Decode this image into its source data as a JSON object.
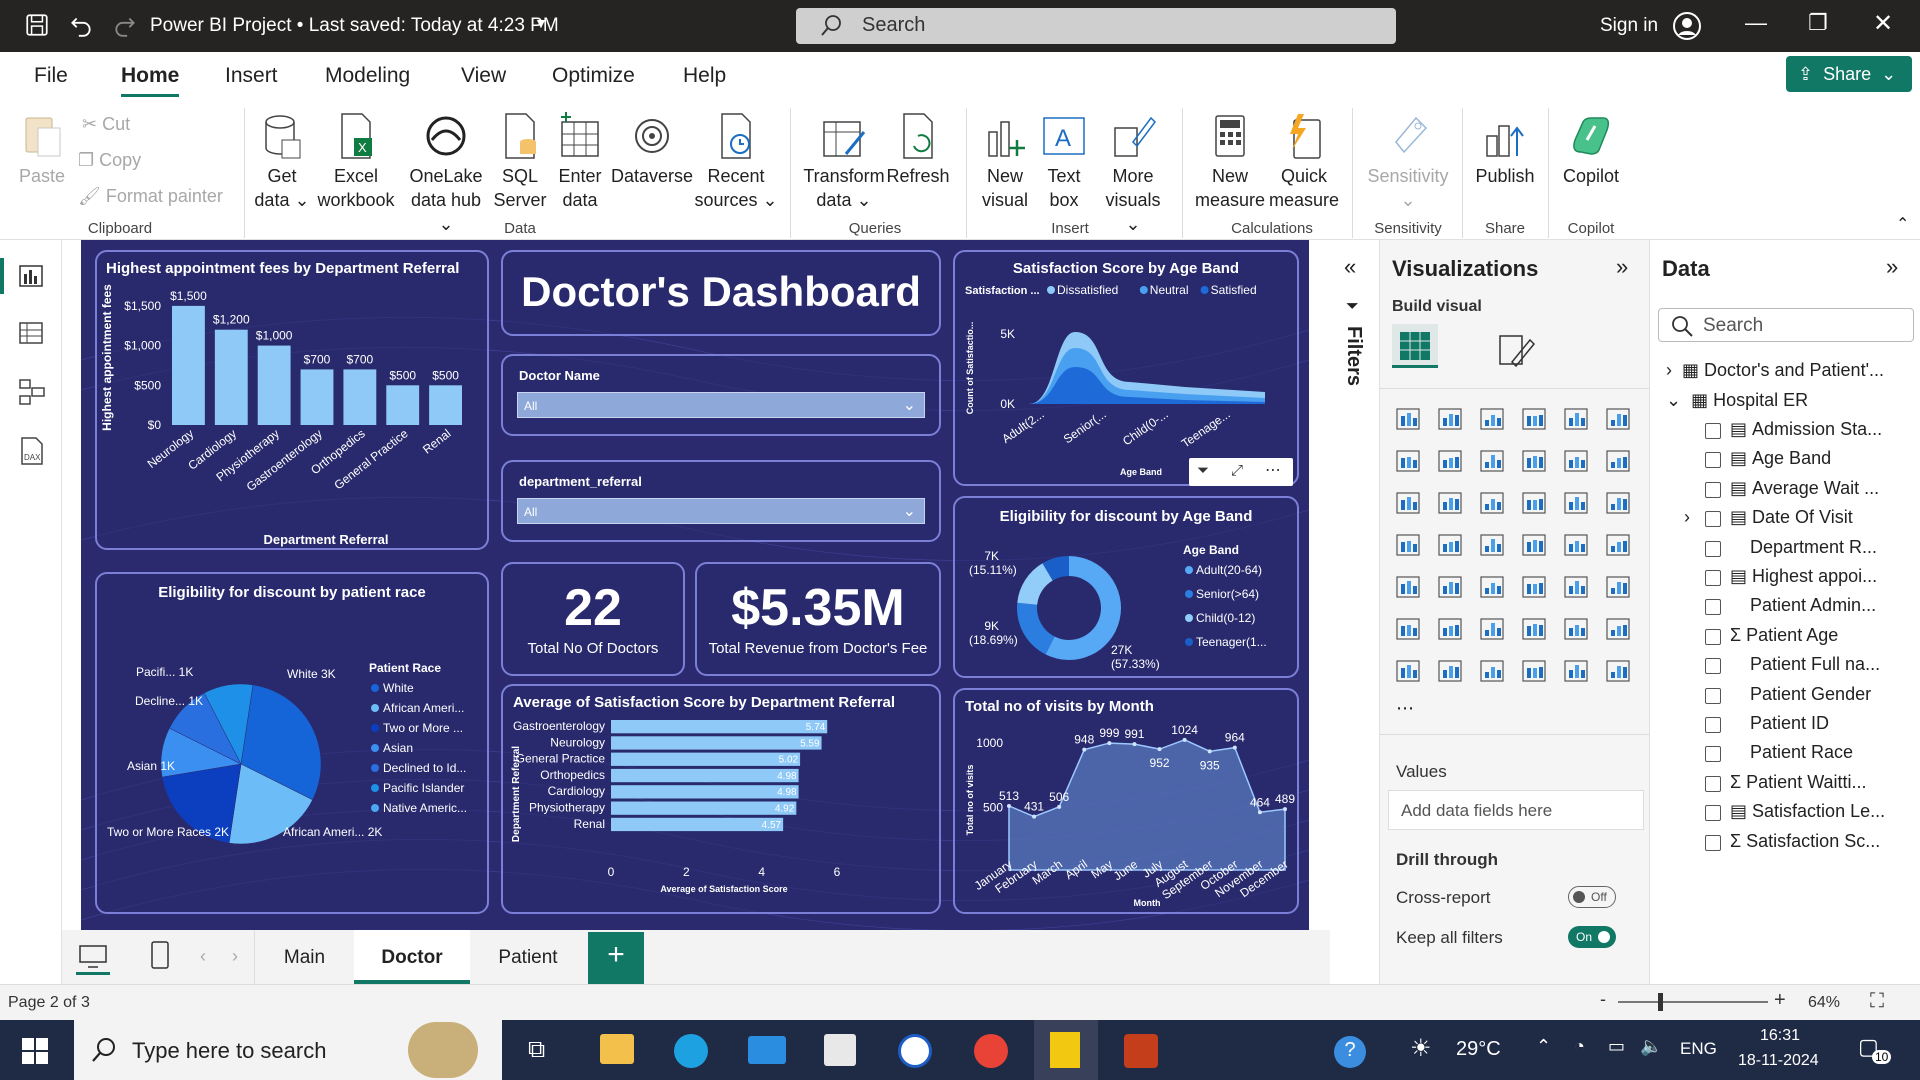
{
  "window": {
    "title": "Power BI Project • Last saved: Today at 4:23 PM",
    "search_placeholder": "Search",
    "signin": "Sign in"
  },
  "menu": {
    "items": [
      "File",
      "Home",
      "Insert",
      "Modeling",
      "View",
      "Optimize",
      "Help"
    ],
    "active": "Home",
    "share": "Share"
  },
  "ribbon": {
    "clipboard": {
      "paste": "Paste",
      "cut": "Cut",
      "copy": "Copy",
      "format_painter": "Format painter",
      "group": "Clipboard"
    },
    "data": {
      "get_data": [
        "Get",
        "data"
      ],
      "excel": [
        "Excel",
        "workbook"
      ],
      "onelake": [
        "OneLake",
        "data hub"
      ],
      "sql": [
        "SQL",
        "Server"
      ],
      "enter": [
        "Enter",
        "data"
      ],
      "dataverse": "Dataverse",
      "recent": [
        "Recent",
        "sources"
      ],
      "group": "Data"
    },
    "queries": {
      "transform": [
        "Transform",
        "data"
      ],
      "refresh": "Refresh",
      "group": "Queries"
    },
    "insert": {
      "new_visual": [
        "New",
        "visual"
      ],
      "text_box": [
        "Text",
        "box"
      ],
      "more_visuals": [
        "More",
        "visuals"
      ],
      "group": "Insert"
    },
    "calculations": {
      "new_measure": [
        "New",
        "measure"
      ],
      "quick_measure": [
        "Quick",
        "measure"
      ],
      "group": "Calculations"
    },
    "sensitivity": {
      "label": "Sensitivity",
      "group": "Sensitivity"
    },
    "share": {
      "publish": "Publish",
      "group": "Share"
    },
    "copilot": {
      "label": "Copilot",
      "group": "Copilot"
    }
  },
  "dashboard": {
    "title": "Doctor's Dashboard",
    "fees_chart_title": "Highest appointment fees by Department Referral",
    "race_chart_title": "Eligibility for discount by patient race",
    "satisfaction_age_title": "Satisfaction Score by Age Band",
    "eligibility_age_title": "Eligibility for discount by Age Band",
    "avg_sat_title": "Average of Satisfaction Score by Department Referral",
    "visits_title": "Total no of visits by Month",
    "slicer1": {
      "label": "Doctor Name",
      "value": "All"
    },
    "slicer2": {
      "label": "department_referral",
      "value": "All"
    },
    "kpi1": {
      "value": "22",
      "label": "Total No Of Doctors"
    },
    "kpi2": {
      "value": "$5.35M",
      "label": "Total Revenue from Doctor's Fee"
    }
  },
  "chart_data": [
    {
      "type": "bar",
      "title": "Highest appointment fees by Department Referral",
      "categories": [
        "Neurology",
        "Cardiology",
        "Physiotherapy",
        "Gastroenterology",
        "Orthopedics",
        "General Practice",
        "Renal"
      ],
      "values": [
        1500,
        1200,
        1000,
        700,
        700,
        500,
        500
      ],
      "data_labels": [
        "$1,500",
        "$1,200",
        "$1,000",
        "$700",
        "$700",
        "$500",
        "$500"
      ],
      "xlabel": "Department Referral",
      "ylabel": "Highest appointment fees",
      "ylim": [
        0,
        1700
      ],
      "yticks": [
        "$0",
        "$500",
        "$1,000",
        "$1,500"
      ],
      "color": "#8ec9f7"
    },
    {
      "type": "area",
      "title": "Satisfaction Score by Age Band",
      "legend_title": "Satisfaction ...",
      "series_names": [
        "Dissatisfied",
        "Neutral",
        "Satisfied"
      ],
      "categories": [
        "Adult(2...",
        "Senior(...",
        "Child(0-...",
        "Teenage..."
      ],
      "xlabel": "Age Band",
      "ylabel": "Count of Satisfactio...",
      "yticks": [
        "0K",
        "5K"
      ]
    },
    {
      "type": "pie",
      "title": "Eligibility for discount by patient race",
      "legend_title": "Patient Race",
      "slices": [
        {
          "name": "White",
          "value": 3000,
          "label": "White 3K",
          "color": "#1565d8"
        },
        {
          "name": "African American",
          "value": 2000,
          "label": "African Ameri... 2K",
          "color": "#6cbcf7"
        },
        {
          "name": "Two or More Races",
          "value": 2000,
          "label": "Two or More Races 2K",
          "color": "#0b3fbf"
        },
        {
          "name": "Asian",
          "value": 1000,
          "label": "Asian 1K",
          "color": "#3a8ff0"
        },
        {
          "name": "Declined to Identify",
          "value": 1000,
          "label": "Decline... 1K",
          "color": "#2a6fe0"
        },
        {
          "name": "Pacific Islander",
          "value": 1000,
          "label": "Pacifi... 1K",
          "color": "#1e90e8"
        }
      ],
      "legend": [
        "White",
        "African Ameri...",
        "Two or More ...",
        "Asian",
        "Declined to Id...",
        "Pacific Islander",
        "Native Americ..."
      ]
    },
    {
      "type": "pie",
      "title": "Eligibility for discount by Age Band",
      "legend_title": "Age Band",
      "slices": [
        {
          "name": "Adult(20-64)",
          "value": 27000,
          "label": "27K (57.33%)",
          "color": "#57a8f5"
        },
        {
          "name": "Senior(>64)",
          "value": 9000,
          "label": "9K (18.69%)",
          "color": "#2b7de0"
        },
        {
          "name": "Child(0-12)",
          "value": 7000,
          "label": "7K (15.11%)",
          "color": "#92cdfa"
        },
        {
          "name": "Teenager(13-19)",
          "value": 4000,
          "label": "",
          "color": "#1a5fc8"
        }
      ],
      "legend": [
        "Adult(20-64)",
        "Senior(>64)",
        "Child(0-12)",
        "Teenager(1..."
      ]
    },
    {
      "type": "bar",
      "orientation": "horizontal",
      "title": "Average of Satisfaction Score by Department Referral",
      "categories": [
        "Gastroenterology",
        "Neurology",
        "General Practice",
        "Orthopedics",
        "Cardiology",
        "Physiotherapy",
        "Renal"
      ],
      "values": [
        5.74,
        5.59,
        5.02,
        4.98,
        4.98,
        4.92,
        4.57
      ],
      "xlabel": "Average of Satisfaction Score",
      "ylabel": "Department Referral",
      "xlim": [
        0,
        6
      ],
      "xticks": [
        "0",
        "2",
        "4",
        "6"
      ],
      "color": "#8ec9f7"
    },
    {
      "type": "area",
      "title": "Total no of visits by Month",
      "categories": [
        "January",
        "February",
        "March",
        "April",
        "May",
        "June",
        "July",
        "August",
        "September",
        "October",
        "November",
        "December"
      ],
      "values": [
        513,
        431,
        506,
        948,
        999,
        991,
        952,
        1024,
        935,
        964,
        464,
        489
      ],
      "xlabel": "Month",
      "ylabel": "Total no of visits",
      "yticks": [
        "500",
        "1000"
      ]
    }
  ],
  "filters": {
    "label": "Filters"
  },
  "viz": {
    "title": "Visualizations",
    "build": "Build visual",
    "values": "Values",
    "add_fields": "Add data fields here",
    "drill": "Drill through",
    "cross": "Cross-report",
    "cross_state": "Off",
    "keep": "Keep all filters",
    "keep_state": "On"
  },
  "data": {
    "title": "Data",
    "search": "Search",
    "tables": [
      "Doctor's and Patient'...",
      "Hospital ER"
    ],
    "fields": [
      "Admission Sta...",
      "Age Band",
      "Average Wait ...",
      "Date Of Visit",
      "Department R...",
      "Highest appoi...",
      "Patient Admin...",
      "Patient Age",
      "Patient Full na...",
      "Patient Gender",
      "Patient ID",
      "Patient Race",
      "Patient Waitti...",
      "Satisfaction Le...",
      "Satisfaction Sc..."
    ]
  },
  "tabs": {
    "items": [
      "Main",
      "Doctor",
      "Patient"
    ],
    "active": "Doctor"
  },
  "status": {
    "page": "Page 2 of 3",
    "zoom": "64%"
  },
  "taskbar": {
    "search": "Type here to search",
    "temp": "29°C",
    "lang": "ENG",
    "time": "16:31",
    "date": "18-11-2024",
    "notif": "10"
  }
}
